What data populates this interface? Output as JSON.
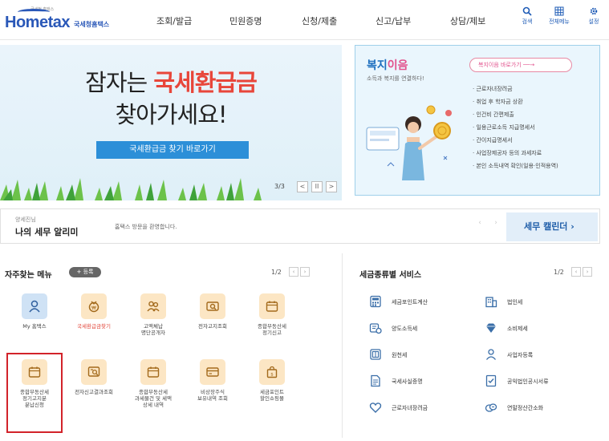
{
  "header": {
    "logo_sub": "국세청 홈택스",
    "logo_word": "Hometax",
    "logo_korean": "국세청홈택스",
    "nav": [
      "조회/발급",
      "민원증명",
      "신청/제출",
      "신고/납부",
      "상담/제보"
    ],
    "utils": [
      {
        "icon": "search-icon",
        "label": "검색"
      },
      {
        "icon": "grid-menu-icon",
        "label": "전체메뉴"
      },
      {
        "icon": "gear-icon",
        "label": "설정"
      }
    ]
  },
  "banner": {
    "line1_prefix": "잠자는 ",
    "line1_highlight": "국세환급금",
    "line2": "찾아가세요!",
    "cta": "국세환급금 찾기 바로가기",
    "pager": "3/3",
    "prev": "<",
    "pause": "II",
    "next": ">",
    "colors": {
      "accent": "#e8463a",
      "cta": "#2c8fd8"
    }
  },
  "welfare": {
    "title_part1": "복지",
    "title_part2": "이음",
    "desc": "소득과 복지를 연결하다!",
    "go": "복지이음 바로가기 ──→",
    "items": [
      "근로자녀장려금",
      "취업 후 학자금 상환",
      "인건비 간편제출",
      "일용근로소득 지급명세서",
      "간이지급명세서",
      "사업장제공자 등의 과세자료",
      "본인 소득내역 확인(일용·인적용역)"
    ]
  },
  "alert": {
    "small": "양세진님",
    "big": "나의 세무 알리미",
    "message": "홈택스 방문을 환영합니다.",
    "calendar": "세무 캘린더  ›"
  },
  "favorites": {
    "title": "자주찾는 메뉴",
    "plus": "+ 등록",
    "page": "1/2",
    "items": [
      {
        "label": "My 홈택스",
        "icon": "user-icon",
        "red": false,
        "blue": true
      },
      {
        "label": "국세환급금찾기",
        "icon": "refund-icon",
        "red": true,
        "blue": false
      },
      {
        "label": "고액체납\n명단공개자",
        "icon": "people-icon",
        "red": false,
        "blue": false
      },
      {
        "label": "전자고지조회",
        "icon": "notice-search-icon",
        "red": false,
        "blue": false
      },
      {
        "label": "종합부동산세\n정기신고",
        "icon": "calendar-icon",
        "red": false,
        "blue": false
      },
      {
        "label": "종합부동산세\n정기고지분\n분납신청",
        "icon": "calendar-icon",
        "red": false,
        "blue": false
      },
      {
        "label": "전자신고결과조회",
        "icon": "doc-search-icon",
        "red": false,
        "blue": false
      },
      {
        "label": "종합부동산세\n과세물건 및 세액\n상세 내역",
        "icon": "calendar-icon",
        "red": false,
        "blue": false
      },
      {
        "label": "비상장주식\n보유내역 조회",
        "icon": "card-icon",
        "red": false,
        "blue": false
      },
      {
        "label": "세금포인트\n할인쇼핑몰",
        "icon": "shopping-bag-icon",
        "red": false,
        "blue": false
      }
    ]
  },
  "services": {
    "title": "세금종류별 서비스",
    "page": "1/2",
    "items": [
      {
        "label": "세금포인트계산",
        "icon": "calculator-icon"
      },
      {
        "label": "법인세",
        "icon": "building-icon"
      },
      {
        "label": "양도소득세",
        "icon": "transfer-icon"
      },
      {
        "label": "소비제세",
        "icon": "diamond-icon"
      },
      {
        "label": "원천세",
        "icon": "ledger-icon"
      },
      {
        "label": "사업자등록",
        "icon": "person-search-icon"
      },
      {
        "label": "국세사실증명",
        "icon": "certificate-icon"
      },
      {
        "label": "공익법인공시서류",
        "icon": "document-check-icon"
      },
      {
        "label": "근로자녀장려금",
        "icon": "heart-icon"
      },
      {
        "label": "연말정산간소화",
        "icon": "coins-icon"
      }
    ]
  }
}
